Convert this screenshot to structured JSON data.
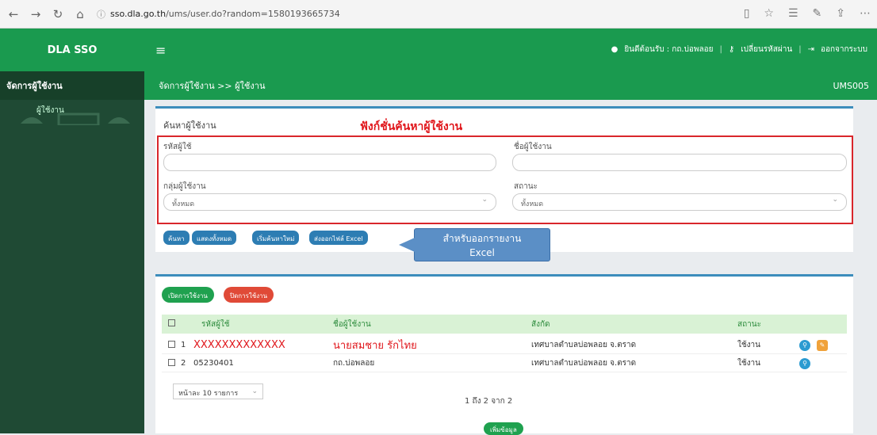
{
  "browser": {
    "url_host": "sso.dla.go.th",
    "url_rest": "/ums/user.do?random=1580193665734",
    "nav_icons": [
      "back-icon",
      "forward-icon",
      "refresh-icon",
      "home-icon"
    ],
    "right_icons": [
      "reading-view-icon",
      "favorite-icon",
      "favorites-list-icon",
      "notes-icon",
      "share-icon",
      "more-icon"
    ]
  },
  "app": {
    "brand": "DLA SSO",
    "menu_icon": "≡",
    "user_text": "ยินดีต้อนรับ : กถ.บ่อพลอย",
    "change_password": "เปลี่ยนรหัสผ่าน",
    "logout": "ออกจากระบบ"
  },
  "sidebar": {
    "header": "จัดการผู้ใช้งาน",
    "items": [
      {
        "label": "ผู้ใช้งาน"
      }
    ]
  },
  "mainhead": {
    "breadcrumb": "จัดการผู้ใช้งาน >> ผู้ใช้งาน",
    "code": "UMS005"
  },
  "search": {
    "title": "ค้นหาผู้ใช้งาน",
    "callout": "ฟังก์ชั่นค้นหาผู้ใช้งาน",
    "fields": {
      "user_id_label": "รหัสผู้ใช้",
      "user_name_label": "ชื่อผู้ใช้งาน",
      "group_label": "กลุ่มผู้ใช้งาน",
      "group_value": "ทั้งหมด",
      "status_label": "สถานะ",
      "status_value": "ทั้งหมด"
    },
    "buttons": {
      "search": "ค้นหา",
      "show_all": "แสดงทั้งหมด",
      "reset": "เริ่มค้นหาใหม่",
      "export": "ส่งออกไฟล์ Excel"
    },
    "export_callout_line1": "สำหรับออกรายงาน",
    "export_callout_line2": "Excel"
  },
  "results": {
    "enable_btn": "เปิดการใช้งาน",
    "disable_btn": "ปิดการใช้งาน",
    "columns": [
      "รหัสผู้ใช้",
      "ชื่อผู้ใช้งาน",
      "สังกัด",
      "สถานะ"
    ],
    "rows": [
      {
        "no": "1",
        "user_id": "XXXXXXXXXXXXX",
        "name": "นายสมชาย รักไทย",
        "org": "เทศบาลตำบลบ่อพลอย จ.ตราด",
        "status": "ใช้งาน"
      },
      {
        "no": "2",
        "user_id": "05230401",
        "name": "กถ.บ่อพลอย",
        "org": "เทศบาลตำบลบ่อพลอย จ.ตราด",
        "status": "ใช้งาน"
      }
    ],
    "page_size": "หน้าละ 10 รายการ",
    "page_info": "1 ถึง 2 จาก 2",
    "more": "เพิ่มข้อมูล"
  },
  "colors": {
    "brand_green": "#1a9a4f",
    "sidebar_dark": "#1f4a34",
    "accent_blue": "#3c8dbc",
    "danger_red": "#d9262b"
  }
}
